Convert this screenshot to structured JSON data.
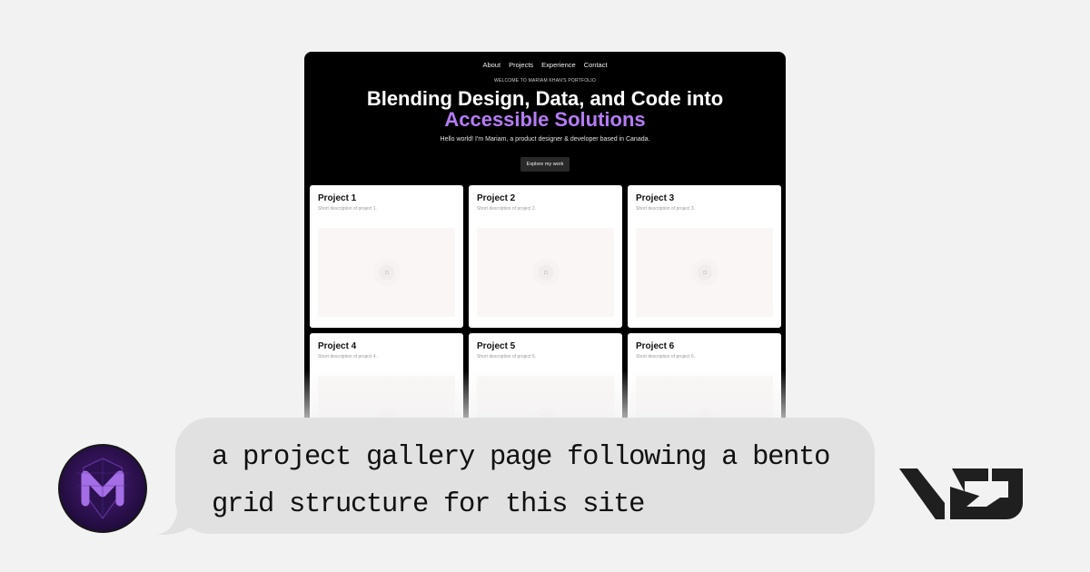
{
  "nav": {
    "items": [
      "About",
      "Projects",
      "Experience",
      "Contact"
    ]
  },
  "hero": {
    "eyebrow": "WELCOME TO MARIAM KHAN'S PORTFOLIO",
    "headline_line1": "Blending Design, Data, and Code into",
    "headline_line2": "Accessible Solutions",
    "intro": "Hello world! I'm Mariam, a product designer & developer based in Canada.",
    "cta": "Explore my work"
  },
  "projects": [
    {
      "title": "Project 1",
      "desc": "Short description of project 1."
    },
    {
      "title": "Project 2",
      "desc": "Short description of project 2."
    },
    {
      "title": "Project 3",
      "desc": "Short description of project 3."
    },
    {
      "title": "Project 4",
      "desc": "Short description of project 4."
    },
    {
      "title": "Project 5",
      "desc": "Short description of project 5."
    },
    {
      "title": "Project 6",
      "desc": "Short description of project 6."
    }
  ],
  "chat": {
    "prompt": "a project gallery page following a bento grid structure for this site"
  },
  "icons": {
    "avatar": "m-logo-avatar-icon",
    "brand": "v0-logo-icon",
    "image_placeholder": "image-placeholder-icon"
  },
  "colors": {
    "accent": "#b57cf5",
    "panel": "#000000",
    "bubble": "#e1e1e1",
    "avatar": "#4a1d78"
  }
}
